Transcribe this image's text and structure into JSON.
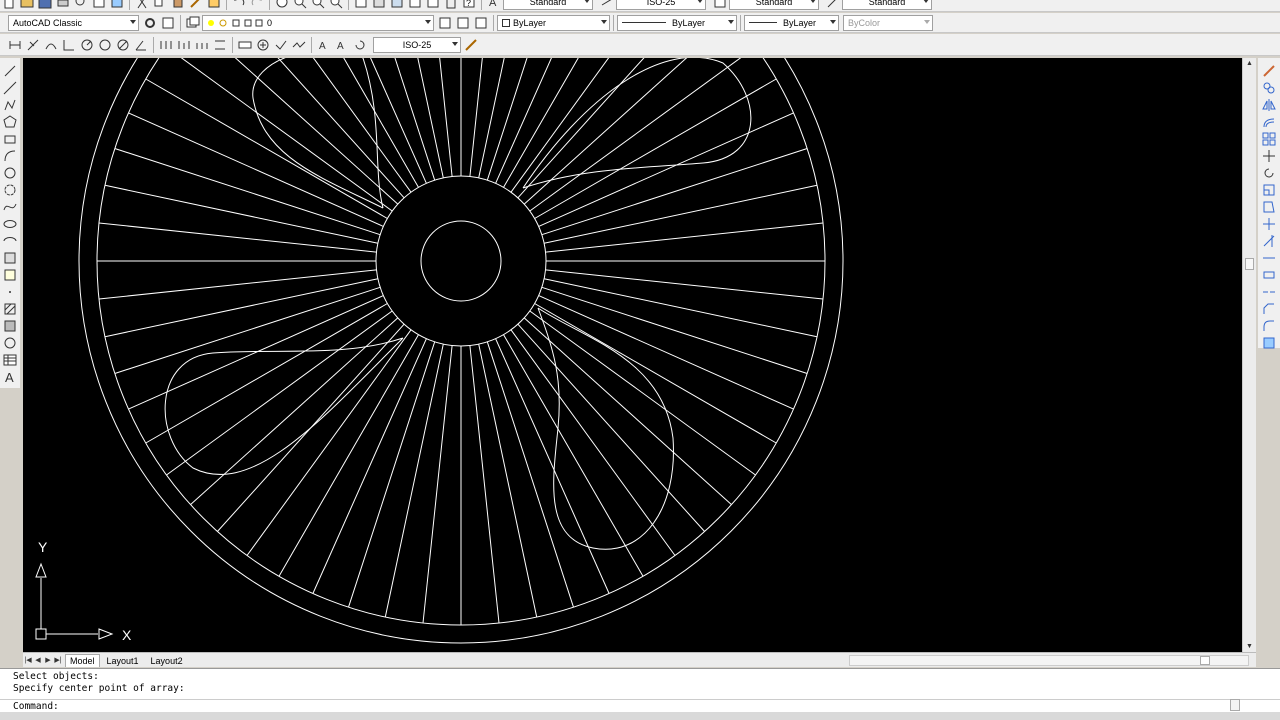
{
  "toolbar1": {
    "text_style": "Standard",
    "dim_style": "ISO-25",
    "table_style": "Standard",
    "multileader_style": "Standard"
  },
  "toolbar2": {
    "workspace": "AutoCAD Classic",
    "layer": "0",
    "color": "ByLayer",
    "linetype": "ByLayer",
    "lineweight": "ByLayer",
    "plotstyle": "ByColor"
  },
  "toolbar3": {
    "dim_style": "ISO-25"
  },
  "ucs": {
    "x_label": "X",
    "y_label": "Y"
  },
  "tabs": [
    "Model",
    "Layout1",
    "Layout2"
  ],
  "command": {
    "history": [
      "Select objects:",
      "Specify center point of array:"
    ],
    "prompt": "Command:"
  },
  "colors": {
    "canvas": "#000000",
    "linework": "#ffffff"
  }
}
